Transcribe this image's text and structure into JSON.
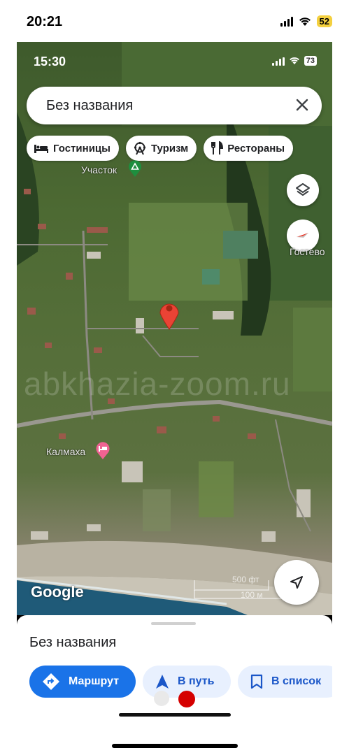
{
  "outer_status": {
    "time": "20:21",
    "battery": "52"
  },
  "inner_status": {
    "time": "15:30",
    "battery": "73"
  },
  "search": {
    "value": "Без названия"
  },
  "chips": [
    {
      "label": "Гостиницы",
      "icon": "bed-icon"
    },
    {
      "label": "Туризм",
      "icon": "ferris-wheel-icon"
    },
    {
      "label": "Рестораны",
      "icon": "fork-knife-icon"
    }
  ],
  "map": {
    "labels": {
      "uchastok": "Участок",
      "gostevo": "Гостево",
      "kalmakha": "Калмаха"
    },
    "watermark": "abkhazia-zoom.ru",
    "google": "Google",
    "scale_ft": "500 фт",
    "scale_m": "100 м"
  },
  "sheet": {
    "title": "Без названия",
    "buttons": {
      "route": "Маршрут",
      "start": "В путь",
      "save": "В список"
    }
  },
  "colors": {
    "accent": "#1a73e8",
    "secondary_bg": "#e8f0fe",
    "pin": "#ea4335",
    "battery_badge": "#f4d03f"
  }
}
